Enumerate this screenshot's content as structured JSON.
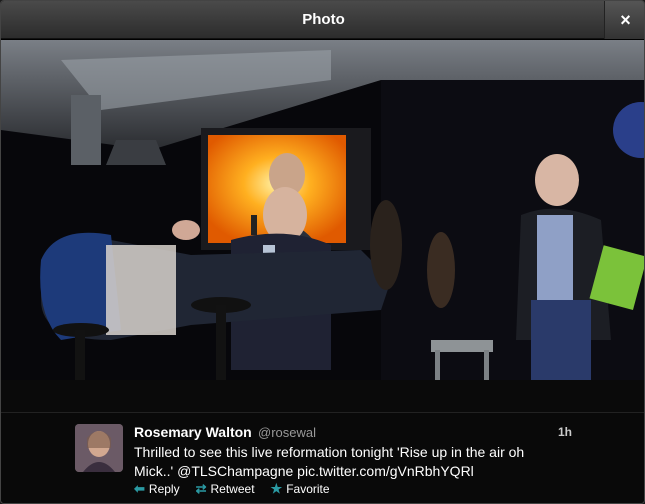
{
  "modal": {
    "title": "Photo",
    "close_label": "×"
  },
  "tweet": {
    "name": "Rosemary Walton",
    "handle": "@rosewal",
    "time": "1h",
    "text": "Thrilled to see this live reformation tonight 'Rise up in the air oh Mick..' @TLSChampagne pic.twitter.com/gVnRbhYQRl",
    "actions": {
      "reply": "Reply",
      "retweet": "Retweet",
      "favorite": "Favorite"
    }
  },
  "icons": {
    "reply": "reply-arrow-icon",
    "retweet": "retweet-icon",
    "favorite": "star-icon",
    "close": "close-icon"
  }
}
